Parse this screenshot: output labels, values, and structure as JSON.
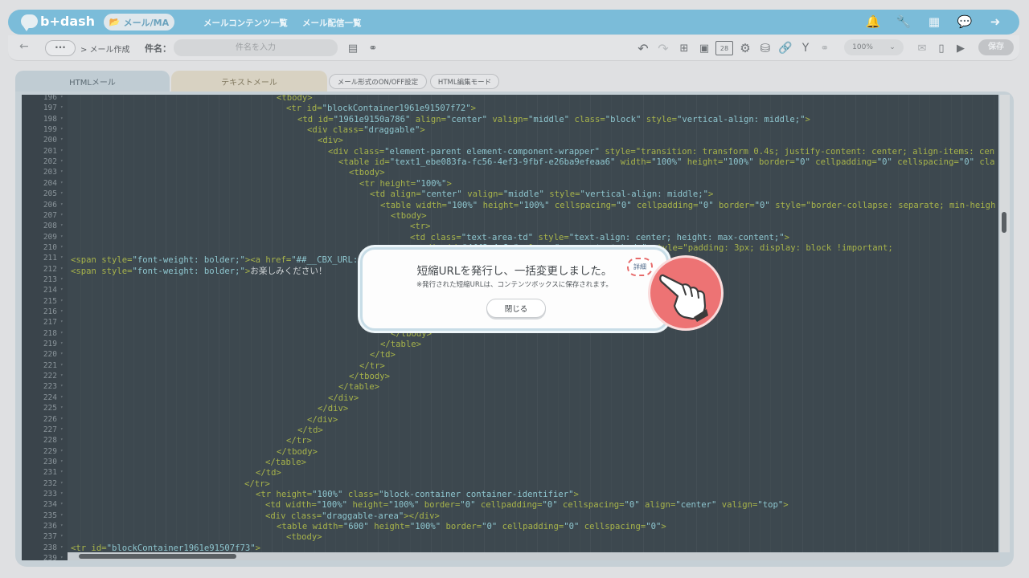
{
  "header": {
    "logo_text": "b+dash",
    "active_nav": "メール/MA",
    "nav_items": [
      "メールコンテンツ一覧",
      "メール配信一覧"
    ],
    "icons": [
      "bell-icon",
      "wrench-icon",
      "grid-icon",
      "chat-icon",
      "logout-icon"
    ]
  },
  "toolbar": {
    "breadcrumb": "> メール作成",
    "subject_label": "件名：",
    "subject_placeholder": "件名を入力",
    "zoom": "100%",
    "save_label": "保存",
    "calendar_day": "28"
  },
  "tabs": {
    "html_label": "HTMLメール",
    "text_label": "テキストメール",
    "format_toggle_label": "メール形式のON/OFF設定",
    "html_mode_label": "HTML編集モード"
  },
  "editor": {
    "line_numbers": [
      "196",
      "197",
      "198",
      "199",
      "200",
      "201",
      "202",
      "203",
      "204",
      "205",
      "206",
      "207",
      "208",
      "209",
      "210",
      "211",
      "212",
      "213",
      "214",
      "215",
      "216",
      "217",
      "218",
      "219",
      "220",
      "221",
      "222",
      "223",
      "224",
      "225",
      "226",
      "227",
      "228",
      "229",
      "230",
      "231",
      "232",
      "233",
      "234",
      "235",
      "236",
      "237",
      "238",
      "239"
    ],
    "lines": [
      "<tbody>",
      "<tr id=\"blockContainer1961e91507f72\">",
      "<td id=\"1961e9150a786\" align=\"center\" valign=\"middle\" class=\"block\" style=\"vertical-align: middle;\">",
      "<div class=\"draggable\">",
      "<div>",
      "<div class=\"element-parent element-component-wrapper\" style=\"transition: transform 0.4s; justify-content: center; align-items: cent",
      "<table id=\"text1_ebe083fa-fc56-4ef3-9fbf-e26ba9efeaa6\" width=\"100%\" height=\"100%\" border=\"0\" cellpadding=\"0\" cellspacing=\"0\" cla",
      "<tbody>",
      "<tr height=\"100%\">",
      "<td align=\"center\" valign=\"middle\" style=\"vertical-align: middle;\">",
      "<table width=\"100%\" height=\"100%\" cellspacing=\"0\" cellpadding=\"0\" border=\"0\" style=\"border-collapse: separate; min-heigh",
      "<tbody>",
      "<tr>",
      "<td class=\"text-area-td\" style=\"text-align: center; height: max-content;\">",
      "<div id=\"4ff2a4a8-\" class=\"mce-content-body\" style=\"padding: 3px; display: block !important;",
      "<span style=\"font-weight: bolder;\"><a href=\"##__CBX_URL:2294__##\">新作</a",
      "<span style=\"font-weight: bolder;\">お楽しみください！",
      "",
      "",
      "",
      "",
      "",
      "</tbody>",
      "</table>",
      "</td>",
      "</tr>",
      "</tbody>",
      "</table>",
      "</div>",
      "</div>",
      "</div>",
      "</td>",
      "</tr>",
      "</tbody>",
      "</table>",
      "</td>",
      "</tr>",
      "<tr height=\"100%\" class=\"block-container container-identifier\">",
      "<td width=\"100%\" height=\"100%\" border=\"0\" cellpadding=\"0\" cellspacing=\"0\" align=\"center\" valign=\"top\">",
      "<div class=\"draggable-area\"></div>",
      "<table width=\"600\" height=\"100%\" border=\"0\" cellpadding=\"0\" cellspacing=\"0\">",
      "<tbody>",
      "<tr id=\"blockContainer1961e91507f73\">",
      ""
    ]
  },
  "dialog": {
    "title": "短縮URLを発行し、一括変更しました。",
    "note": "※発行された短縮URLは、コンテンツボックスに保存されます。",
    "close_label": "閉じる",
    "detail_label": "詳細"
  }
}
